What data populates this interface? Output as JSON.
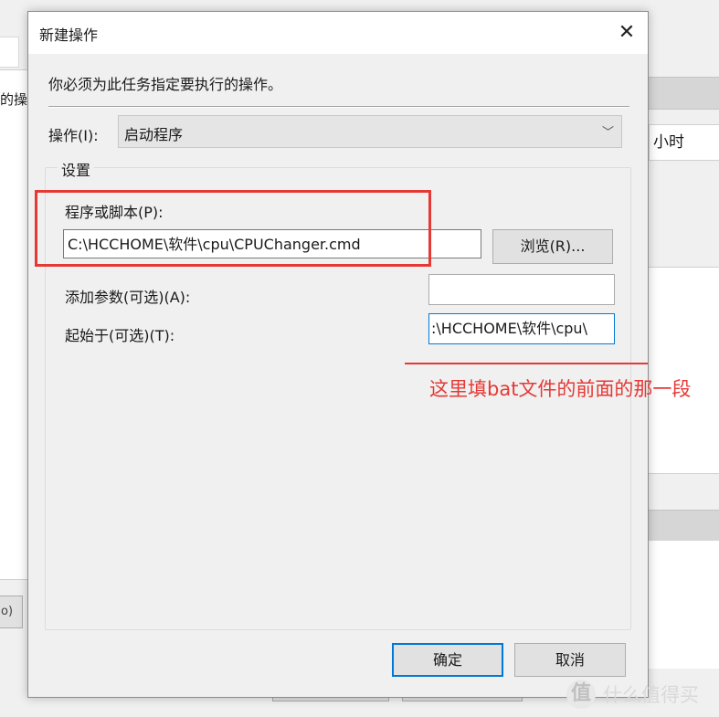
{
  "background": {
    "left_fragment_text": "的操作",
    "left_button_fragment": "o)",
    "right_hour_text": "小时"
  },
  "dialog": {
    "title": "新建操作",
    "close_glyph": "✕",
    "instruction": "你必须为此任务指定要执行的操作。",
    "action_label": "操作(I):",
    "action_value": "启动程序",
    "group_title": "设置",
    "program_label": "程序或脚本(P):",
    "program_value": "C:\\HCCHOME\\软件\\cpu\\CPUChanger.cmd",
    "browse_label": "浏览(R)...",
    "args_label": "添加参数(可选)(A):",
    "args_value": "",
    "start_label": "起始于(可选)(T):",
    "start_value": ":\\HCCHOME\\软件\\cpu\\",
    "ok_label": "确定",
    "cancel_label": "取消"
  },
  "annotation": {
    "text": "这里填bat文件的前面的那一段",
    "color": "#e53935"
  },
  "watermark": {
    "logo_glyph": "值",
    "text": "什么值得买"
  },
  "colors": {
    "focus_blue": "#0078d7",
    "dialog_bg": "#f0f0f0"
  }
}
